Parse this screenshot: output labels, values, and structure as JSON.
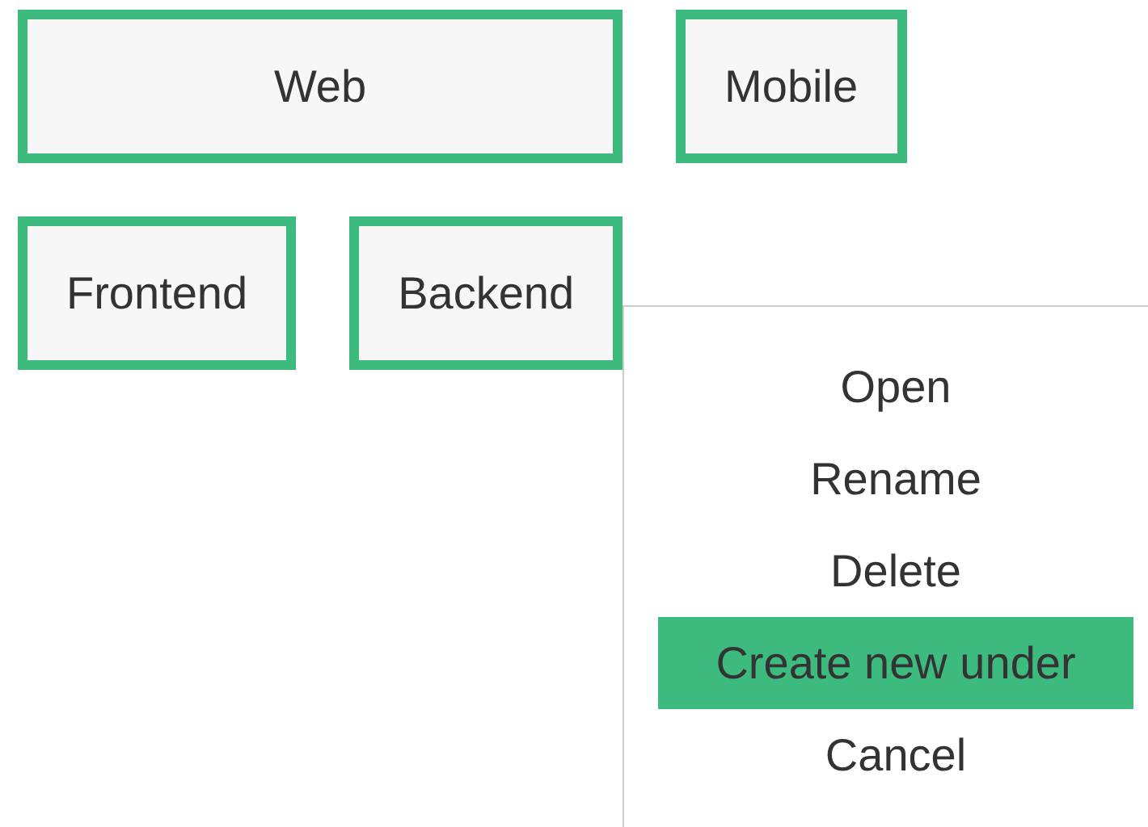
{
  "nodes": [
    {
      "label": "Web",
      "children": [
        {
          "label": "Frontend"
        },
        {
          "label": "Backend"
        }
      ]
    },
    {
      "label": "Mobile"
    }
  ],
  "context_menu": {
    "items": [
      {
        "label": "Open",
        "selected": false
      },
      {
        "label": "Rename",
        "selected": false
      },
      {
        "label": "Delete",
        "selected": false
      },
      {
        "label": "Create new under",
        "selected": true
      },
      {
        "label": "Cancel",
        "selected": false
      }
    ]
  }
}
